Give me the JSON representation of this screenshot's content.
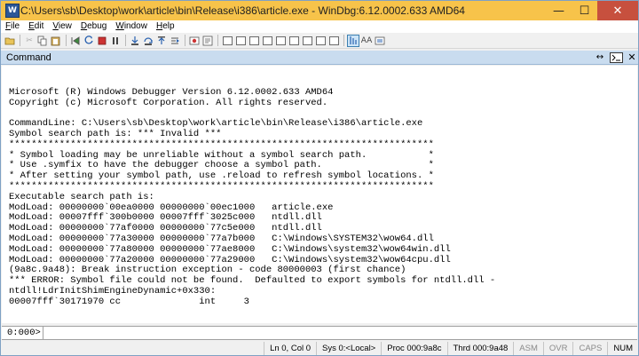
{
  "window": {
    "title": "C:\\Users\\sb\\Desktop\\work\\article\\bin\\Release\\i386\\article.exe - WinDbg:6.12.0002.633 AMD64",
    "app_icon_glyph": "W",
    "minimize_glyph": "—",
    "maximize_glyph": "☐",
    "close_glyph": "✕"
  },
  "menu": {
    "items": [
      {
        "label": "File",
        "accel": "F",
        "rest": "ile"
      },
      {
        "label": "Edit",
        "accel": "E",
        "rest": "dit"
      },
      {
        "label": "View",
        "accel": "V",
        "rest": "iew"
      },
      {
        "label": "Debug",
        "accel": "D",
        "rest": "ebug"
      },
      {
        "label": "Window",
        "accel": "W",
        "rest": "indow"
      },
      {
        "label": "Help",
        "accel": "H",
        "rest": "elp"
      }
    ]
  },
  "toolbar": {
    "font_size_label": "AA"
  },
  "pane": {
    "title": "Command",
    "arrows_glyph": "↔",
    "close_glyph": "✕"
  },
  "output": {
    "lines": [
      "",
      "Microsoft (R) Windows Debugger Version 6.12.0002.633 AMD64",
      "Copyright (c) Microsoft Corporation. All rights reserved.",
      "",
      "CommandLine: C:\\Users\\sb\\Desktop\\work\\article\\bin\\Release\\i386\\article.exe",
      "Symbol search path is: *** Invalid ***",
      "****************************************************************************",
      "* Symbol loading may be unreliable without a symbol search path.           *",
      "* Use .symfix to have the debugger choose a symbol path.                   *",
      "* After setting your symbol path, use .reload to refresh symbol locations. *",
      "****************************************************************************",
      "Executable search path is:",
      "ModLoad: 00000000`00ea0000 00000000`00ec1000   article.exe",
      "ModLoad: 00007fff`300b0000 00007fff`3025c000   ntdll.dll",
      "ModLoad: 00000000`77af0000 00000000`77c5e000   ntdll.dll",
      "ModLoad: 00000000`77a30000 00000000`77a7b000   C:\\Windows\\SYSTEM32\\wow64.dll",
      "ModLoad: 00000000`77a80000 00000000`77ae8000   C:\\Windows\\system32\\wow64win.dll",
      "ModLoad: 00000000`77a20000 00000000`77a29000   C:\\Windows\\system32\\wow64cpu.dll",
      "(9a8c.9a48): Break instruction exception - code 80000003 (first chance)",
      "*** ERROR: Symbol file could not be found.  Defaulted to export symbols for ntdll.dll -",
      "ntdll!LdrInitShimEngineDynamic+0x330:",
      "00007fff`30171970 cc              int     3"
    ]
  },
  "command": {
    "prompt": "0:000>",
    "value": ""
  },
  "status": {
    "cells": [
      {
        "label": "Ln 0, Col 0",
        "active": true
      },
      {
        "label": "Sys 0:<Local>",
        "active": true
      },
      {
        "label": "Proc 000:9a8c",
        "active": true
      },
      {
        "label": "Thrd 000:9a48",
        "active": true
      },
      {
        "label": "ASM",
        "active": false
      },
      {
        "label": "OVR",
        "active": false
      },
      {
        "label": "CAPS",
        "active": false
      },
      {
        "label": "NUM",
        "active": true
      }
    ]
  }
}
